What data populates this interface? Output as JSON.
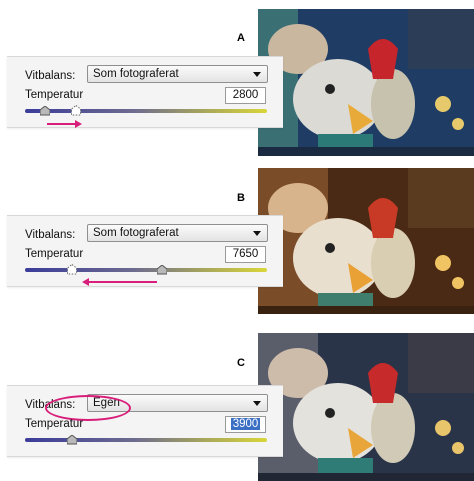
{
  "panels": [
    {
      "id": "A",
      "letter": "A",
      "wb_label": "Vitbalans:",
      "wb_value": "Som fotograferat",
      "temp_label": "Temperatur",
      "temp_value": "2800",
      "temp_selected": false
    },
    {
      "id": "B",
      "letter": "B",
      "wb_label": "Vitbalans:",
      "wb_value": "Som fotograferat",
      "temp_label": "Temperatur",
      "temp_value": "7650",
      "temp_selected": false
    },
    {
      "id": "C",
      "letter": "C",
      "wb_label": "Vitbalans:",
      "wb_value": "Egen",
      "temp_label": "Temperatur",
      "temp_value": "3900",
      "temp_selected": true
    }
  ],
  "colors": {
    "annotation": "#d81e7a",
    "selection": "#3a6fc4"
  },
  "icons": [
    "dropdown-arrow-icon",
    "slider-thumb-icon",
    "annotation-arrow-icon",
    "annotation-circle-icon"
  ]
}
